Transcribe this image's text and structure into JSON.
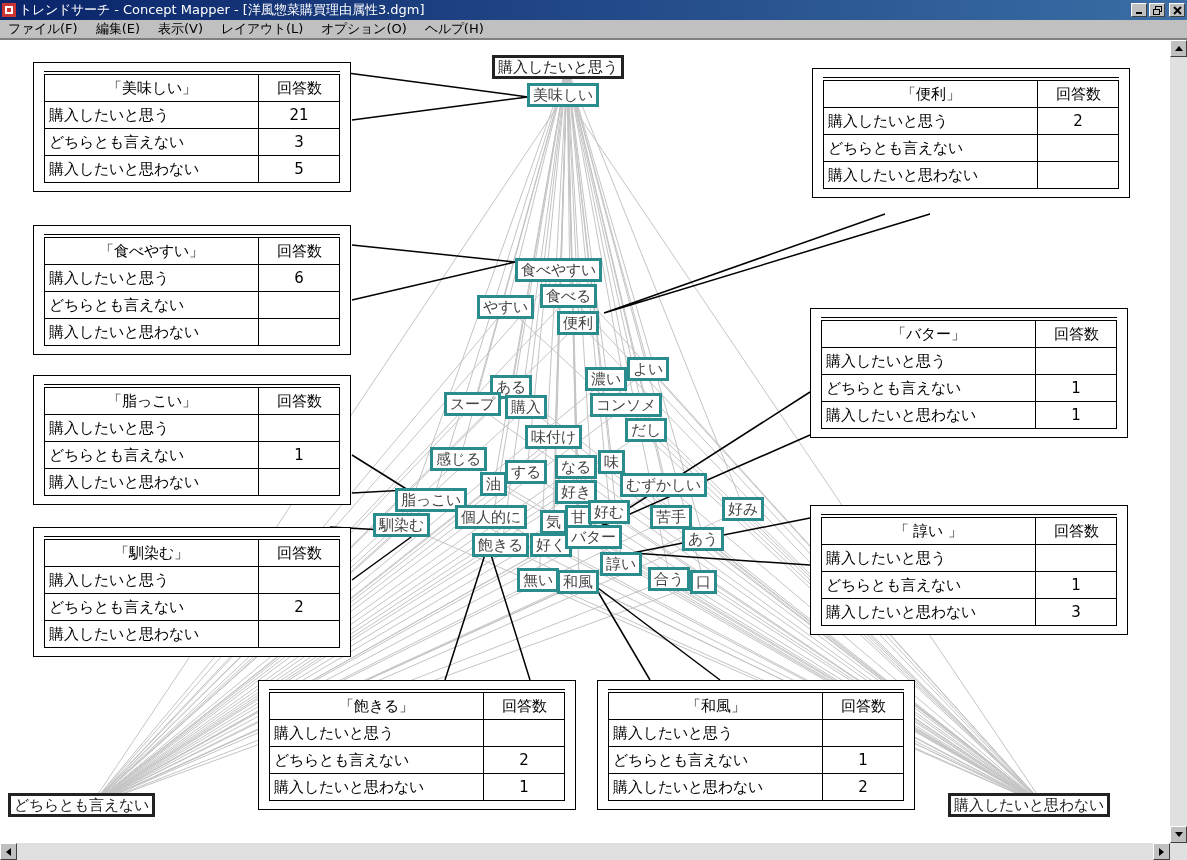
{
  "window": {
    "title": "トレンドサーチ - Concept Mapper - [洋風惣菜購買理由属性3.dgm]"
  },
  "menu": [
    "ファイル(F)",
    "編集(E)",
    "表示(V)",
    "レイアウト(L)",
    "オプション(O)",
    "ヘルプ(H)"
  ],
  "nodes": [
    {
      "label": "購入したいと思う",
      "kind": "anchor"
    },
    {
      "label": "美味しい",
      "kind": "concept"
    },
    {
      "label": "食べやすい",
      "kind": "concept"
    },
    {
      "label": "食べる",
      "kind": "concept"
    },
    {
      "label": "やすい",
      "kind": "concept"
    },
    {
      "label": "便利",
      "kind": "concept"
    },
    {
      "label": "ある",
      "kind": "concept"
    },
    {
      "label": "スープ",
      "kind": "concept"
    },
    {
      "label": "購入",
      "kind": "concept"
    },
    {
      "label": "濃い",
      "kind": "concept"
    },
    {
      "label": "よい",
      "kind": "concept"
    },
    {
      "label": "コンソメ",
      "kind": "concept"
    },
    {
      "label": "味付け",
      "kind": "concept"
    },
    {
      "label": "だし",
      "kind": "concept"
    },
    {
      "label": "感じる",
      "kind": "concept"
    },
    {
      "label": "油",
      "kind": "concept"
    },
    {
      "label": "する",
      "kind": "concept"
    },
    {
      "label": "なる",
      "kind": "concept"
    },
    {
      "label": "味",
      "kind": "concept"
    },
    {
      "label": "好き",
      "kind": "concept"
    },
    {
      "label": "むずかしい",
      "kind": "concept"
    },
    {
      "label": "脂っこい",
      "kind": "concept"
    },
    {
      "label": "個人的に",
      "kind": "concept"
    },
    {
      "label": "気",
      "kind": "concept"
    },
    {
      "label": "甘",
      "kind": "concept"
    },
    {
      "label": "好む",
      "kind": "concept"
    },
    {
      "label": "苦手",
      "kind": "concept"
    },
    {
      "label": "好み",
      "kind": "concept"
    },
    {
      "label": "馴染む",
      "kind": "concept"
    },
    {
      "label": "飽きる",
      "kind": "concept"
    },
    {
      "label": "好く",
      "kind": "concept"
    },
    {
      "label": "バター",
      "kind": "concept"
    },
    {
      "label": "あう",
      "kind": "concept"
    },
    {
      "label": "諄い",
      "kind": "concept"
    },
    {
      "label": "無い",
      "kind": "concept"
    },
    {
      "label": "和風",
      "kind": "concept"
    },
    {
      "label": "合う",
      "kind": "concept"
    },
    {
      "label": "口",
      "kind": "concept"
    },
    {
      "label": "どちらとも言えない",
      "kind": "anchor"
    },
    {
      "label": "購入したいと思わない",
      "kind": "anchor"
    }
  ],
  "callouts": [
    {
      "term": "「美味しい」",
      "header": "回答数",
      "rows": [
        {
          "label": "購入したいと思う",
          "count": "21"
        },
        {
          "label": "どちらとも言えない",
          "count": "3"
        },
        {
          "label": "購入したいと思わない",
          "count": "5"
        }
      ]
    },
    {
      "term": "「便利」",
      "header": "回答数",
      "rows": [
        {
          "label": "購入したいと思う",
          "count": "2"
        },
        {
          "label": "どちらとも言えない"
        },
        {
          "label": "購入したいと思わない"
        }
      ]
    },
    {
      "term": "「食べやすい」",
      "header": "回答数",
      "rows": [
        {
          "label": "購入したいと思う",
          "count": "6"
        },
        {
          "label": "どちらとも言えない"
        },
        {
          "label": "購入したいと思わない"
        }
      ]
    },
    {
      "term": "「バター」",
      "header": "回答数",
      "rows": [
        {
          "label": "購入したいと思う"
        },
        {
          "label": "どちらとも言えない",
          "count": "1"
        },
        {
          "label": "購入したいと思わない",
          "count": "1"
        }
      ]
    },
    {
      "term": "「脂っこい」",
      "header": "回答数",
      "rows": [
        {
          "label": "購入したいと思う"
        },
        {
          "label": "どちらとも言えない",
          "count": "1"
        },
        {
          "label": "購入したいと思わない"
        }
      ]
    },
    {
      "term": "「 諄い 」",
      "header": "回答数",
      "rows": [
        {
          "label": "購入したいと思う"
        },
        {
          "label": "どちらとも言えない",
          "count": "1"
        },
        {
          "label": "購入したいと思わない",
          "count": "3"
        }
      ]
    },
    {
      "term": "「馴染む」",
      "header": "回答数",
      "rows": [
        {
          "label": "購入したいと思う"
        },
        {
          "label": "どちらとも言えない",
          "count": "2"
        },
        {
          "label": "購入したいと思わない"
        }
      ]
    },
    {
      "term": "「飽きる」",
      "header": "回答数",
      "rows": [
        {
          "label": "購入したいと思う"
        },
        {
          "label": "どちらとも言えない",
          "count": "2"
        },
        {
          "label": "購入したいと思わない",
          "count": "1"
        }
      ]
    },
    {
      "term": "「和風」",
      "header": "回答数",
      "rows": [
        {
          "label": "購入したいと思う"
        },
        {
          "label": "どちらとも言えない",
          "count": "1"
        },
        {
          "label": "購入したいと思わない",
          "count": "2"
        }
      ]
    }
  ]
}
